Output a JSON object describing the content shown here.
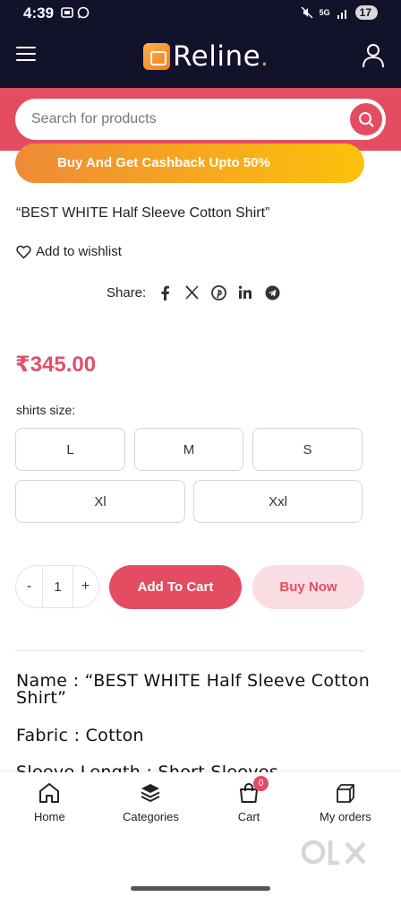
{
  "status_bar": {
    "time": "4:39",
    "network": "5G",
    "battery": "17"
  },
  "header": {
    "brand_name": "Reline",
    "brand_dot": "."
  },
  "search": {
    "placeholder": "Search for products"
  },
  "promo": {
    "text": "Buy And Get Cashback Upto 50%"
  },
  "product": {
    "title": "“BEST WHITE Half Sleeve Cotton Shirt”",
    "wishlist_label": "Add to wishlist",
    "share_label": "Share:",
    "price": "₹345.00",
    "size_label": "shirts size",
    "size_colon": ":",
    "sizes": [
      "L",
      "M",
      "S",
      "Xl",
      "Xxl"
    ],
    "quantity": "1",
    "qty_minus": "-",
    "qty_plus": "+",
    "add_to_cart": "Add To Cart",
    "buy_now": "Buy Now"
  },
  "description": {
    "name": "Name : “BEST WHITE Half Sleeve Cotton Shirt”",
    "fabric": "Fabric : Cotton",
    "sleeve": "Sleeve Length : Short Sleeves"
  },
  "bottom_nav": {
    "items": [
      {
        "label": "Home",
        "icon": "home-icon"
      },
      {
        "label": "Categories",
        "icon": "categories-icon"
      },
      {
        "label": "Cart",
        "icon": "cart-icon"
      },
      {
        "label": "My orders",
        "icon": "orders-icon"
      }
    ],
    "cart_count": "0"
  },
  "watermark": {
    "text": "OLX"
  },
  "colors": {
    "header_bg": "#13122b",
    "accent": "#e44c62",
    "price": "#e0506a",
    "promo_start": "#ef8a38",
    "promo_end": "#fcc20c",
    "buy_now_bg": "#fadde3"
  }
}
